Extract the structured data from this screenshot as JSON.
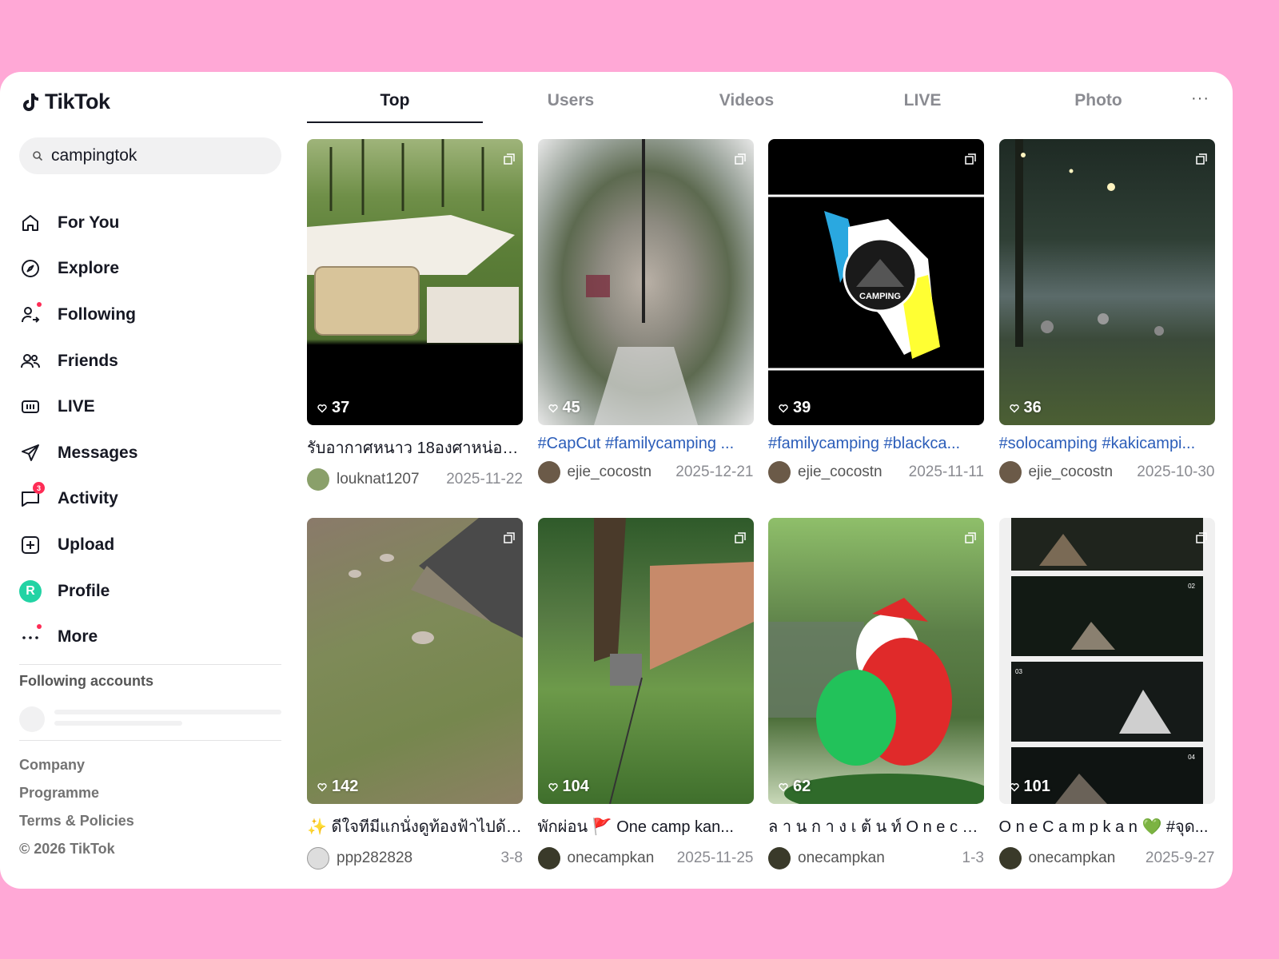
{
  "app": {
    "name": "TikTok"
  },
  "search": {
    "value": "campingtok",
    "placeholder": "Search"
  },
  "nav": [
    {
      "label": "For You",
      "icon": "home-icon"
    },
    {
      "label": "Explore",
      "icon": "compass-icon"
    },
    {
      "label": "Following",
      "icon": "user-follow-icon",
      "dot": true
    },
    {
      "label": "Friends",
      "icon": "friends-icon"
    },
    {
      "label": "LIVE",
      "icon": "live-icon"
    },
    {
      "label": "Messages",
      "icon": "send-icon"
    },
    {
      "label": "Activity",
      "icon": "chat-icon",
      "badge": "3"
    },
    {
      "label": "Upload",
      "icon": "plus-square-icon"
    },
    {
      "label": "Profile",
      "icon": "avatar-icon",
      "avatar_letter": "R"
    },
    {
      "label": "More",
      "icon": "more-dots-icon",
      "dot": true
    }
  ],
  "following_accounts_title": "Following accounts",
  "footer": [
    "Company",
    "Programme",
    "Terms & Policies",
    "© 2026 TikTok"
  ],
  "tabs": [
    "Top",
    "Users",
    "Videos",
    "LIVE",
    "Photo"
  ],
  "tabs_more": "···",
  "colors": {
    "accent": "#fe2c55",
    "hashtag": "#2b5db9",
    "background": "#ffa8d6"
  },
  "videos": [
    {
      "likes": "37",
      "caption": "รับอากาศหนาว 18องศาหน่อย...",
      "caption_is_tag": false,
      "user": "louknat1207",
      "date": "2025-11-22"
    },
    {
      "likes": "45",
      "caption": "#CapCut #familycamping ...",
      "caption_is_tag": true,
      "user": "ejie_cocostn",
      "date": "2025-12-21"
    },
    {
      "likes": "39",
      "caption": "#familycamping #blackca...",
      "caption_is_tag": true,
      "user": "ejie_cocostn",
      "date": "2025-11-11"
    },
    {
      "likes": "36",
      "caption": "#solocamping #kakicampi...",
      "caption_is_tag": true,
      "user": "ejie_cocostn",
      "date": "2025-10-30"
    },
    {
      "likes": "142",
      "caption": "✨ ดีใจทีมีแกนั่งดูท้องฟ้าไปด้ว...",
      "caption_is_tag": false,
      "user": "ppp282828",
      "date": "3-8"
    },
    {
      "likes": "104",
      "caption": "พักผ่อน 🚩 One camp kan...",
      "caption_is_tag": false,
      "user": "onecampkan",
      "date": "2025-11-25"
    },
    {
      "likes": "62",
      "caption": "ล า น ก า ง เ ต้ น ท์ O n e c a...",
      "caption_is_tag": false,
      "user": "onecampkan",
      "date": "1-3"
    },
    {
      "likes": "101",
      "caption": "O n e C a m p k a n 💚 #จุด...",
      "caption_is_tag": false,
      "user": "onecampkan",
      "date": "2025-9-27"
    }
  ],
  "thumb_badges": {
    "camping_logo_text": "CAMPING",
    "collage_labels": [
      "02",
      "03",
      "04"
    ]
  }
}
